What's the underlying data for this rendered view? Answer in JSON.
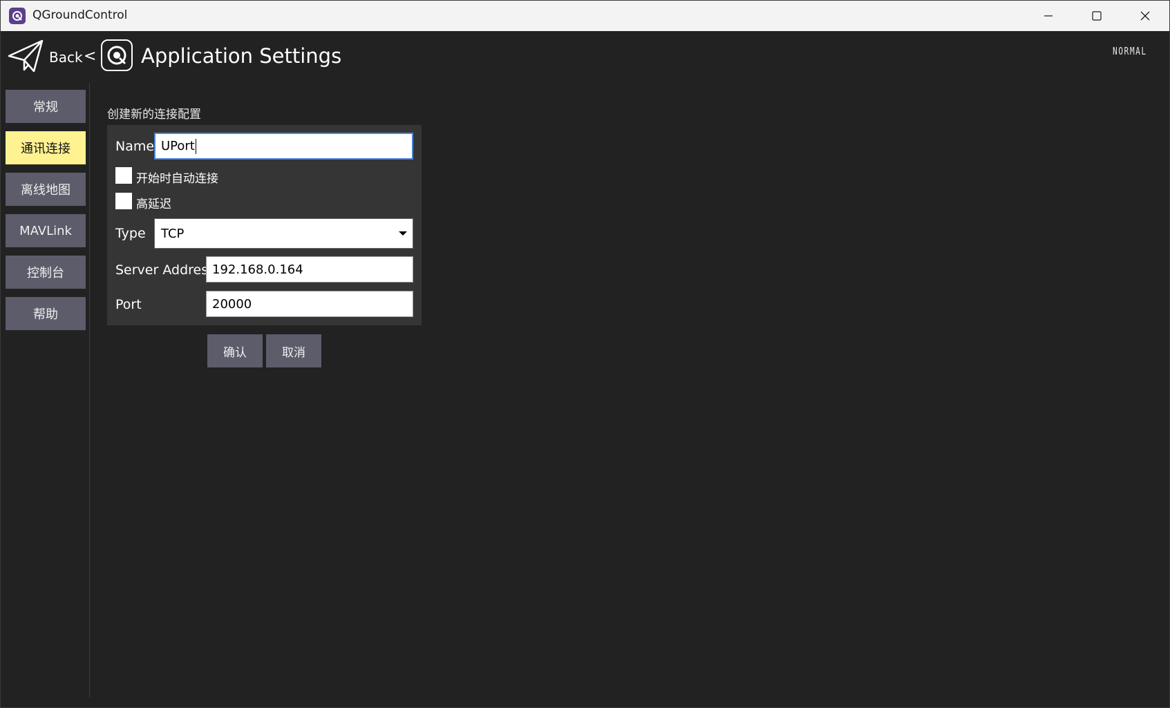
{
  "window": {
    "title": "QGroundControl",
    "controls": [
      "minimize-icon",
      "maximize-icon",
      "close-icon"
    ]
  },
  "header": {
    "back_label": "Back",
    "separator": "<",
    "page_title": "Application Settings",
    "flight_mode": "NORMAL"
  },
  "sidebar": {
    "items": [
      {
        "label": "常规",
        "active": false
      },
      {
        "label": "通讯连接",
        "active": true
      },
      {
        "label": "离线地图",
        "active": false
      },
      {
        "label": "MAVLink",
        "active": false
      },
      {
        "label": "控制台",
        "active": false
      },
      {
        "label": "帮助",
        "active": false
      }
    ]
  },
  "form": {
    "section_title": "创建新的连接配置",
    "name_label": "Name",
    "name_value": "UPort",
    "auto_connect_label": "开始时自动连接",
    "auto_connect_checked": false,
    "high_latency_label": "高延迟",
    "high_latency_checked": false,
    "type_label": "Type",
    "type_value": "TCP",
    "server_address_label": "Server Address",
    "server_address_value": "192.168.0.164",
    "port_label": "Port",
    "port_value": "20000",
    "confirm_label": "确认",
    "cancel_label": "取消"
  },
  "colors": {
    "background": "#222222",
    "panel": "#353535",
    "button": "#5c5c6b",
    "active_button": "#fff291",
    "focus_border": "#4d84d6"
  }
}
